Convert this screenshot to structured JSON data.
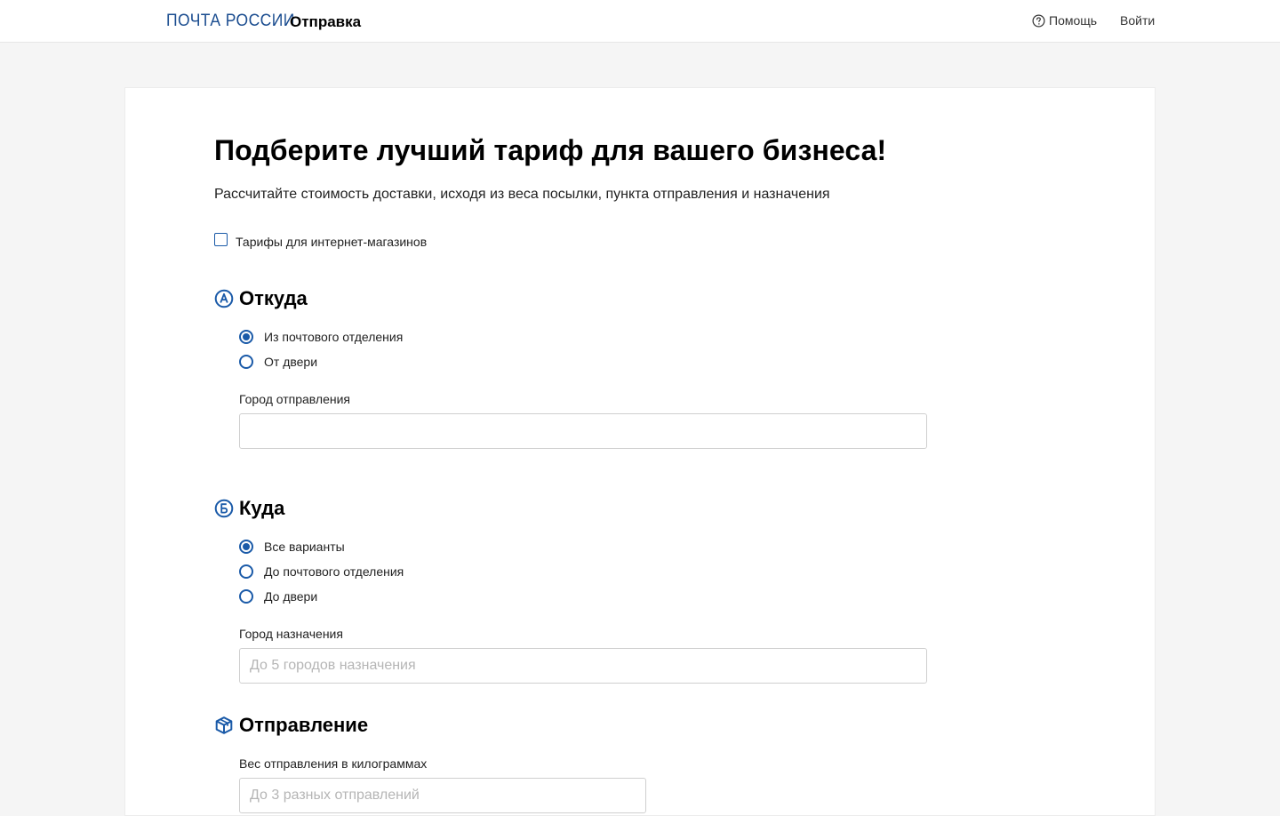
{
  "header": {
    "logo": "ПОЧТА РОССИИ",
    "section": "Отправка",
    "help": "Помощь",
    "login": "Войти",
    "help_icon": "question-circle-icon"
  },
  "page": {
    "title": "Подберите лучший тариф для вашего бизнеса!",
    "subtitle": "Рассчитайте стоимость доставки, исходя из веса посылки, пункта отправления и назначения",
    "ecommerce_checkbox": {
      "label": "Тарифы для интернет-магазинов",
      "checked": false
    }
  },
  "from": {
    "title": "Откуда",
    "icon": "letter-a-circle-icon",
    "options": [
      {
        "label": "Из почтового отделения",
        "checked": true
      },
      {
        "label": "От двери",
        "checked": false
      }
    ],
    "city_label": "Город отправления",
    "city_value": "",
    "city_placeholder": ""
  },
  "to": {
    "title": "Куда",
    "icon": "letter-b-circle-icon",
    "options": [
      {
        "label": "Все варианты",
        "checked": true
      },
      {
        "label": "До почтового отделения",
        "checked": false
      },
      {
        "label": "До двери",
        "checked": false
      }
    ],
    "city_label": "Город назначения",
    "city_value": "",
    "city_placeholder": "До 5 городов назначения"
  },
  "shipment": {
    "title": "Отправление",
    "icon": "package-box-icon",
    "weight_label": "Вес отправления в килограммах",
    "weight_value": "",
    "weight_placeholder": "До 3 разных отправлений"
  },
  "colors": {
    "accent": "#1a5aa8",
    "logo": "#1a4c8f",
    "page_bg": "#f5f5f5",
    "card_bg": "#ffffff",
    "input_border": "#cfcfcf",
    "placeholder": "#b5b5b5"
  }
}
